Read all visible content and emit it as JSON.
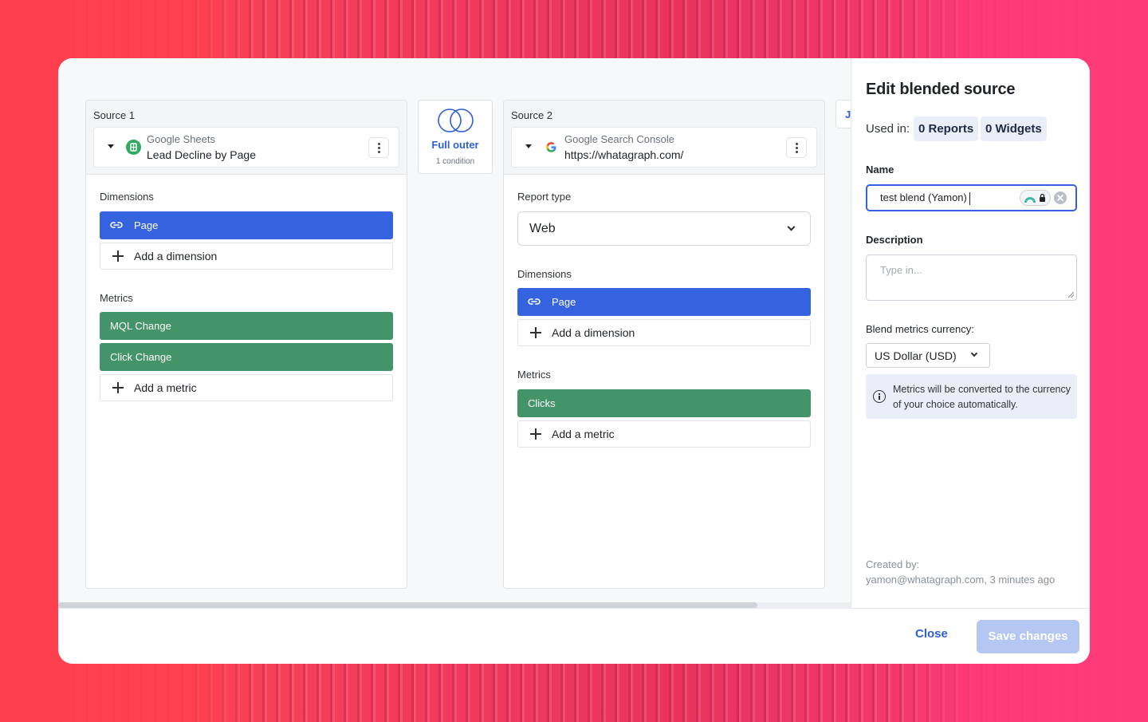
{
  "source1": {
    "title": "Source 1",
    "provider": "Google Sheets",
    "account": "Lead Decline by Page",
    "dimensions_label": "Dimensions",
    "dimensions": [
      "Page"
    ],
    "add_dimension": "Add a dimension",
    "metrics_label": "Metrics",
    "metrics": [
      "MQL Change",
      "Click Change"
    ],
    "add_metric": "Add a metric"
  },
  "join": {
    "type": "Full outer",
    "conditions": "1 condition",
    "next_partial": "J"
  },
  "source2": {
    "title": "Source 2",
    "provider": "Google Search Console",
    "account": "https://whatagraph.com/",
    "report_type_label": "Report type",
    "report_type": "Web",
    "dimensions_label": "Dimensions",
    "dimensions": [
      "Page"
    ],
    "add_dimension": "Add a dimension",
    "metrics_label": "Metrics",
    "metrics": [
      "Clicks"
    ],
    "add_metric": "Add a metric"
  },
  "panel": {
    "title": "Edit blended source",
    "used_in_label": "Used in:",
    "reports_badge": "0 Reports",
    "widgets_badge": "0 Widgets",
    "name_label": "Name",
    "name_value": "test blend (Yamon)",
    "description_label": "Description",
    "description_placeholder": "Type in...",
    "currency_label": "Blend metrics currency:",
    "currency_value": "US Dollar (USD)",
    "info_text": "Metrics will be converted to the currency of your choice automatically.",
    "created_label": "Created by:",
    "created_value": "yamon@whatagraph.com, 3 minutes ago"
  },
  "footer": {
    "close_label": "Close",
    "save_label": "Save changes"
  },
  "colors": {
    "primary": "#3563e0",
    "dimension_pill": "#3563e0",
    "metric_pill": "#44946a",
    "save_disabled": "#b3c7f2"
  },
  "icons": {
    "google_sheets": "sheets-icon",
    "google": "google-g-icon",
    "link": "link-icon",
    "info": "info-icon"
  }
}
